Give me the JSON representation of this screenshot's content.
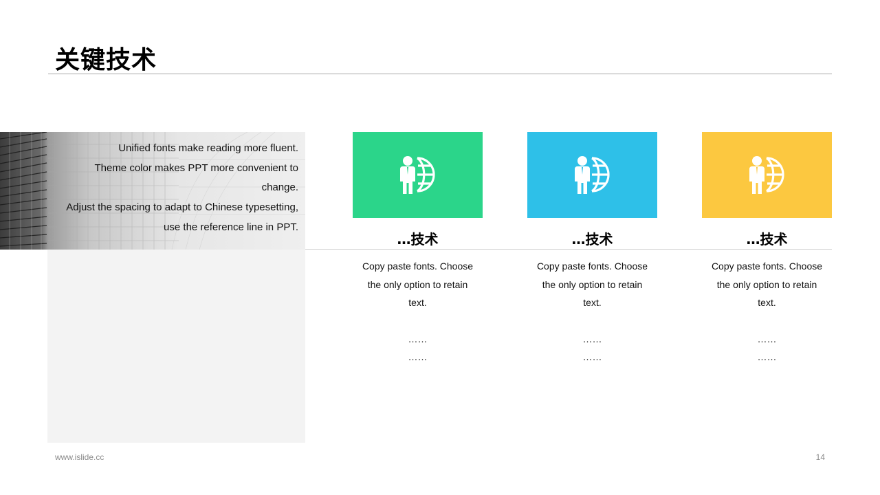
{
  "slide": {
    "title": "关键技术",
    "page_number": "14",
    "footer_url": "www.islide.cc"
  },
  "left_panel": {
    "lines": [
      "Unified fonts make reading more fluent.",
      "Theme color makes PPT more convenient to",
      "change.",
      "Adjust the spacing to adapt to Chinese typesetting,",
      "use the reference line in PPT."
    ]
  },
  "cards": [
    {
      "icon": "businessman-globe-icon",
      "color": "#2bd58a",
      "title": "…技术",
      "desc_lines": [
        "Copy paste fonts. Choose",
        "the only option to retain",
        "text."
      ],
      "dots": [
        "……",
        "……"
      ]
    },
    {
      "icon": "businessman-globe-icon",
      "color": "#2ec0e8",
      "title": "…技术",
      "desc_lines": [
        "Copy paste fonts. Choose",
        "the only option to retain",
        "text."
      ],
      "dots": [
        "……",
        "……"
      ]
    },
    {
      "icon": "businessman-globe-icon",
      "color": "#fcc840",
      "title": "…技术",
      "desc_lines": [
        "Copy paste fonts. Choose",
        "the only option to retain",
        "text."
      ],
      "dots": [
        "……",
        "……"
      ]
    }
  ]
}
